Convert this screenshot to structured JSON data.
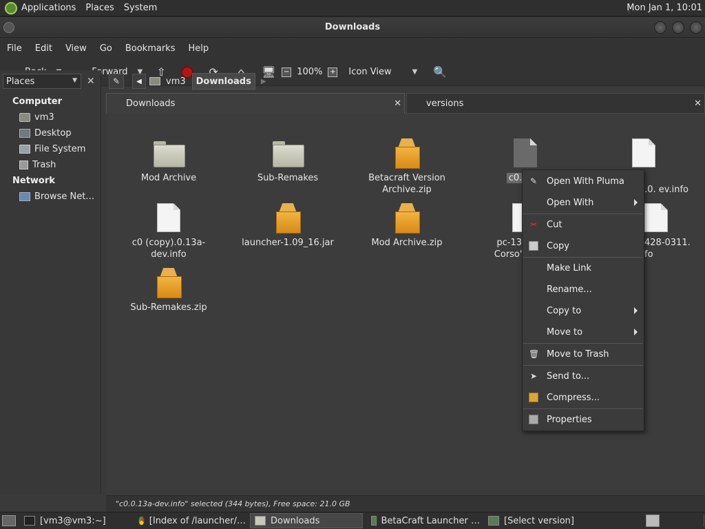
{
  "top_panel": {
    "menus": [
      "Applications",
      "Places",
      "System"
    ],
    "clock": "Mon Jan 1, 10:01"
  },
  "window": {
    "title": "Downloads"
  },
  "menubar": [
    "File",
    "Edit",
    "View",
    "Go",
    "Bookmarks",
    "Help"
  ],
  "toolbar": {
    "back_label": "Back",
    "forward_label": "Forward",
    "zoom_level": "100%",
    "view_mode": "Icon View"
  },
  "sidebar": {
    "combo": "Places",
    "sections": [
      {
        "heading": "Computer",
        "items": [
          "vm3",
          "Desktop",
          "File System",
          "Trash"
        ]
      },
      {
        "heading": "Network",
        "items": [
          "Browse Net…"
        ]
      }
    ]
  },
  "location": {
    "crumbs": [
      "vm3",
      "Downloads"
    ]
  },
  "tabs": [
    "Downloads",
    "versions"
  ],
  "files": [
    {
      "name": "Mod Archive",
      "type": "folder"
    },
    {
      "name": "Sub-Remakes",
      "type": "folder"
    },
    {
      "name": "Betacraft Version Archive.zip",
      "type": "archive"
    },
    {
      "name": "c0.0.13",
      "type": "doc-selected"
    },
    {
      "name": "er copy).0. ev.info",
      "type": "doc"
    },
    {
      "name": "c0 (copy).0.13a-dev.info",
      "type": "doc"
    },
    {
      "name": "launcher-1.09_16.jar",
      "type": "archive"
    },
    {
      "name": "Mod Archive.zip",
      "type": "archive"
    },
    {
      "name": "pc-1316 Corso's V",
      "type": "doc"
    },
    {
      "name": "428-0311. fo",
      "type": "doc"
    },
    {
      "name": "Sub-Remakes.zip",
      "type": "archive"
    }
  ],
  "context_menu": [
    {
      "label": "Open With Pluma",
      "icon": "pluma-icon",
      "submenu": false
    },
    {
      "label": "Open With",
      "icon": "",
      "submenu": true
    },
    {
      "label": "Cut",
      "icon": "scissors-icon",
      "submenu": false
    },
    {
      "label": "Copy",
      "icon": "copy-icon",
      "submenu": false
    },
    {
      "label": "Make Link",
      "icon": "",
      "submenu": false
    },
    {
      "label": "Rename...",
      "icon": "",
      "submenu": false
    },
    {
      "label": "Copy to",
      "icon": "",
      "submenu": true
    },
    {
      "label": "Move to",
      "icon": "",
      "submenu": true
    },
    {
      "label": "Move to Trash",
      "icon": "trash-icon",
      "submenu": false
    },
    {
      "label": "Send to...",
      "icon": "send-icon",
      "submenu": false
    },
    {
      "label": "Compress...",
      "icon": "compress-icon",
      "submenu": false
    },
    {
      "label": "Properties",
      "icon": "properties-icon",
      "submenu": false
    }
  ],
  "statusbar": "\"c0.0.13a-dev.info\" selected (344 bytes), Free space: 21.0 GB",
  "taskbar": [
    {
      "label": "[vm3@vm3:~]",
      "icon": "terminal-icon",
      "active": false
    },
    {
      "label": "[Index of /launcher/…",
      "icon": "chrome-icon",
      "active": false
    },
    {
      "label": "Downloads",
      "icon": "folder-icon",
      "active": true
    },
    {
      "label": "BetaCraft Launcher …",
      "icon": "java-icon",
      "active": false
    },
    {
      "label": "[Select version]",
      "icon": "java-icon",
      "active": false
    }
  ]
}
